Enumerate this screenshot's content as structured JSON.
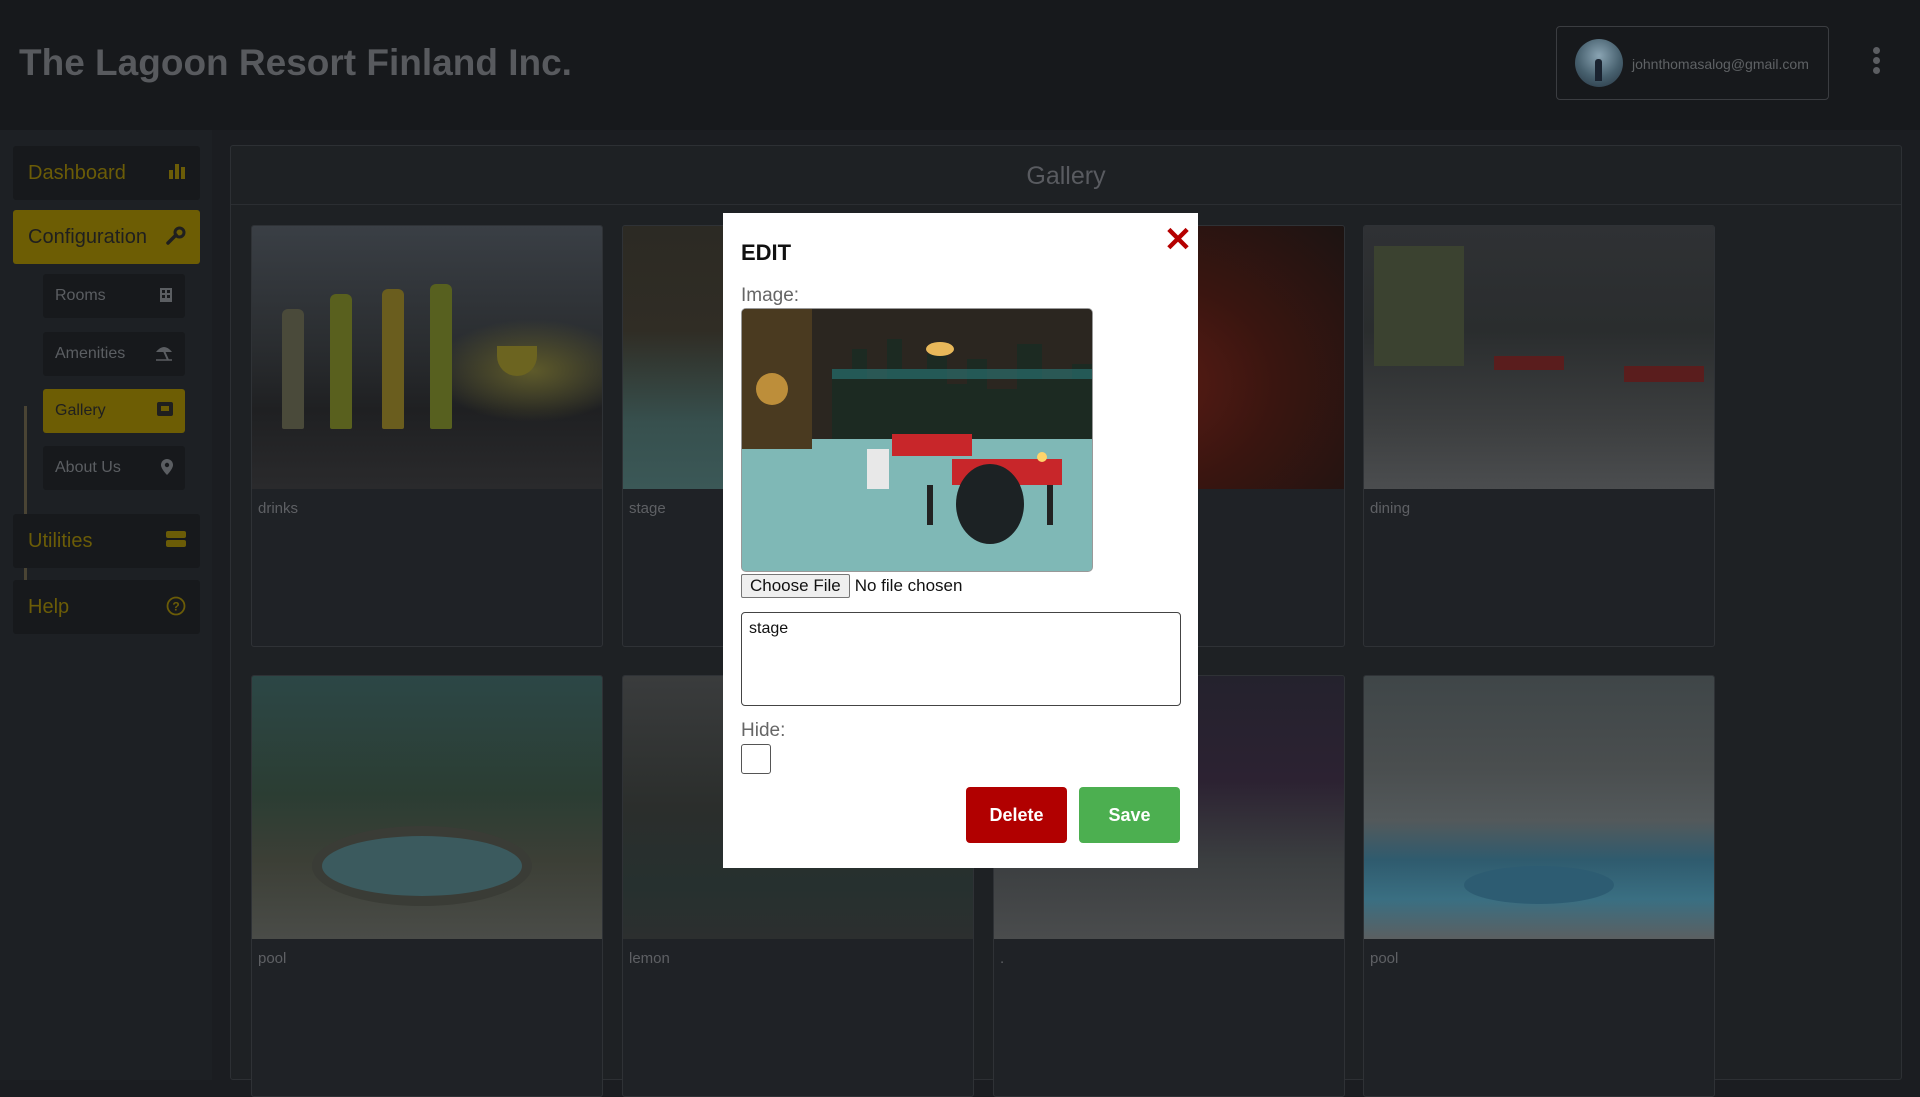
{
  "header": {
    "title": "The Lagoon Resort Finland Inc.",
    "user_email": "johnthomasalog@gmail.com"
  },
  "sidebar": {
    "items": [
      {
        "label": "Dashboard",
        "icon": "bar-chart-icon"
      },
      {
        "label": "Configuration",
        "icon": "wrench-icon"
      },
      {
        "label": "Utilities",
        "icon": "storage-icon"
      },
      {
        "label": "Help",
        "icon": "help-circle-icon"
      }
    ],
    "sub_items": [
      {
        "label": "Rooms",
        "icon": "building-icon"
      },
      {
        "label": "Amenities",
        "icon": "beach-umbrella-icon"
      },
      {
        "label": "Gallery",
        "icon": "image-box-icon"
      },
      {
        "label": "About Us",
        "icon": "map-pin-icon"
      }
    ],
    "active_item": "Configuration",
    "active_sub_item": "Gallery"
  },
  "main": {
    "title": "Gallery",
    "cards": [
      {
        "caption": "drinks"
      },
      {
        "caption": "stage"
      },
      {
        "caption": ""
      },
      {
        "caption": "dining"
      },
      {
        "caption": "pool"
      },
      {
        "caption": "lemon"
      },
      {
        "caption": "."
      },
      {
        "caption": "pool"
      }
    ]
  },
  "modal": {
    "title": "EDIT",
    "image_label": "Image:",
    "choose_file_label": "Choose File",
    "file_status": "No file chosen",
    "caption_value": "stage",
    "hide_label": "Hide:",
    "hide_checked": false,
    "delete_label": "Delete",
    "save_label": "Save"
  },
  "colors": {
    "accent": "#d4b60a",
    "delete": "#b10000",
    "save": "#4caf50",
    "close": "#b50000"
  }
}
